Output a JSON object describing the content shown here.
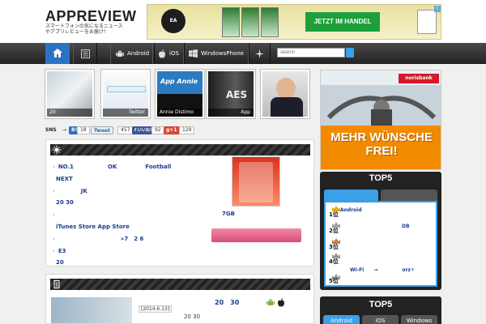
{
  "header": {
    "logo": "APPREVIEW",
    "tagline": "スマートフォンの気になるニュースやアプリレビューをお届け！",
    "ad": {
      "brand": "EA SPORTS",
      "cta": "JETZT IM HANDEL",
      "info": "i"
    }
  },
  "nav": {
    "items": [
      {
        "label": "Android",
        "icon": "android-icon"
      },
      {
        "label": "iOS",
        "icon": "apple-icon"
      },
      {
        "label": "WindowsPhone",
        "icon": "windows-icon"
      }
    ],
    "search_placeholder": "search"
  },
  "thumbnails": [
    {
      "caption": "20"
    },
    {
      "caption": "Twitter"
    },
    {
      "caption": "Annie Distimo",
      "image_text": "App Annie"
    },
    {
      "caption": "App",
      "image_text": "AES"
    },
    {
      "caption": ""
    }
  ],
  "social": {
    "label": "SNS",
    "arrow": "→",
    "hatena": {
      "label": "B!",
      "count": "18"
    },
    "twitter": {
      "label": "Tweet",
      "count": "457"
    },
    "facebook": {
      "label": "f いいね！",
      "count": "92"
    },
    "gplus": {
      "label": "g+1",
      "count": "129"
    }
  },
  "featured": {
    "rows": [
      "NO.1　　　　　　OK　　　　　Football",
      "NEXT",
      "　　　　JK",
      "20  30",
      "",
      "iTunes Store  App Store",
      "　　　　　　　　　　　»7　2  6",
      "E3",
      "20",
      "　　　　　　　　　　　　　　…"
    ],
    "image_caption": "7GB"
  },
  "news": {
    "date": "[2014.6.13]",
    "title": "20　30",
    "sub": "20 30"
  },
  "sidebar": {
    "ad": {
      "bank": "norisbank",
      "headline": "MEHR WÜNSCHE FREI!"
    },
    "ranking1": {
      "title": "TOP5",
      "tabs": [
        "",
        ""
      ],
      "rows": [
        {
          "rank": "1位",
          "text": "Android"
        },
        {
          "rank": "2位",
          "text": "DB"
        },
        {
          "rank": "3位",
          "text": ""
        },
        {
          "rank": "4位",
          "text": ""
        },
        {
          "rank": "5位",
          "text": "Wi-Fi　　→　　　　　orz÷"
        }
      ]
    },
    "ranking2": {
      "title": "TOP5",
      "tabs": [
        "Android",
        "iOS",
        "Windows"
      ]
    }
  },
  "colors": {
    "accent": "#2b73c2",
    "link": "#1a3d8f",
    "button_pink": "#e06a8f",
    "ad_orange": "#f28a00"
  }
}
